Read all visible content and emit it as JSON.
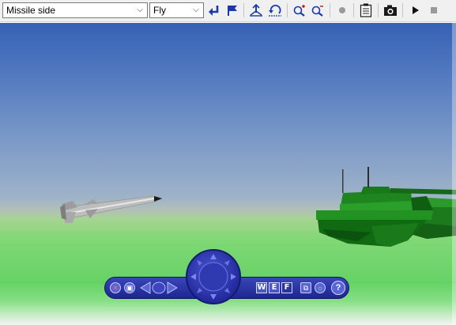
{
  "toolbar": {
    "viewpoint": {
      "value": "Missile side"
    },
    "navigation_mode": {
      "value": "Fly"
    },
    "buttons": [
      "go-back-icon",
      "flag-icon",
      "straighten-icon",
      "restore-icon",
      "zoom-in-icon",
      "zoom-out-icon",
      "record-icon",
      "clipboard-icon",
      "camera-icon",
      "play-icon",
      "stop-icon"
    ]
  },
  "nav_widget": {
    "keys": {
      "w": "W",
      "e": "E",
      "f": "F"
    },
    "help": "?"
  },
  "colors": {
    "sky_top": "#3761b5",
    "ground": "#66d266",
    "nav_widget": "#2a34a8",
    "tank": "#1f8a1f"
  }
}
